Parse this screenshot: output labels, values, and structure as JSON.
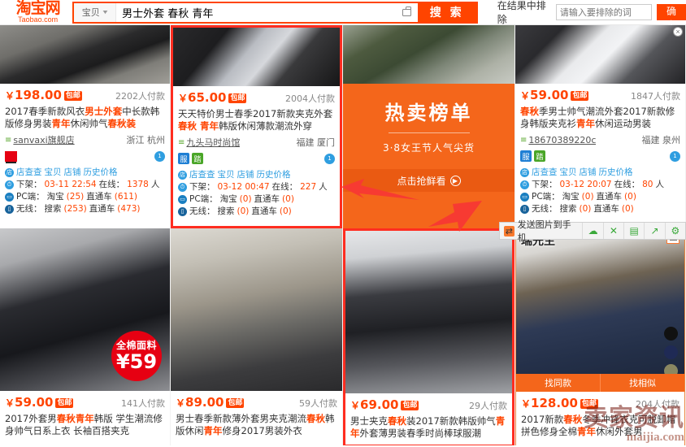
{
  "header": {
    "logo_cn": "淘宝网",
    "logo_en": "Taobao.com",
    "category": "宝贝",
    "search_value": "男士外套 春秋 青年",
    "camera_icon": "camera-icon",
    "search_button": "搜 索",
    "exclude_label": "在结果中排除",
    "exclude_placeholder": "请输入要排除的词",
    "confirm_button": "确定",
    "close_label": "×"
  },
  "promo": {
    "title": "热卖榜单",
    "subtitle": "3·8女王节人气尖货",
    "cta": "点击抢鲜看",
    "cta_arrow": "▶"
  },
  "toolbar": {
    "send_label": "发送图片到手机",
    "buttons": [
      {
        "name": "cloud-icon",
        "glyph": "☁"
      },
      {
        "name": "shuffle-icon",
        "glyph": "✕"
      },
      {
        "name": "save-icon",
        "glyph": "▤"
      },
      {
        "name": "share-icon",
        "glyph": "↗"
      },
      {
        "name": "settings-icon",
        "glyph": "⚙"
      }
    ]
  },
  "labels": {
    "stat_shop_check": "店查查",
    "stat_baobei": "宝贝",
    "stat_dianpu": "店铺",
    "stat_history": "历史价格",
    "stat_offshelf": "下架：",
    "stat_online": "在线：",
    "stat_online_unit": "人",
    "stat_pc": "PC端：",
    "stat_taobao": "淘宝",
    "stat_zhitongche": "直通车",
    "stat_wireless": "无线：",
    "stat_search": "搜索",
    "free_ship": "包邮",
    "menu_icon": "≡"
  },
  "watermark": {
    "cn": "卖家资讯",
    "en": "maijia.com"
  },
  "products": [
    {
      "price": "198.00",
      "deals": "2202人付款",
      "title_parts": [
        {
          "t": "2017春季新款风衣",
          "kw": false
        },
        {
          "t": "男士外套",
          "kw": true
        },
        {
          "t": "中长款韩版修身男装",
          "kw": false
        },
        {
          "t": "青年",
          "kw": true
        },
        {
          "t": "休闲帅气",
          "kw": false
        },
        {
          "t": "春秋装",
          "kw": true
        }
      ],
      "shop": "sanvaxi旗舰店",
      "location": "浙江 杭州",
      "tags": [
        "tmall"
      ],
      "offshelf": "03-11 22:54",
      "online": "1378",
      "pc_taobao": "(25)",
      "pc_ztc": "(611)",
      "wl_search": "(253)",
      "wl_ztc": "(473)",
      "photo": "ph1",
      "highlight": false
    },
    {
      "price": "65.00",
      "deals": "2004人付款",
      "title_parts": [
        {
          "t": "天天特价男士春季2017新款夹克外套",
          "kw": false
        },
        {
          "t": "春秋 青年",
          "kw": true
        },
        {
          "t": "韩版休闲薄款潮流外穿",
          "kw": false
        }
      ],
      "shop": "九头马时尚馆",
      "location": "福建 厦门",
      "tags": [
        "fu",
        "zhan"
      ],
      "offshelf": "03-12 00:47",
      "online": "227",
      "pc_taobao": "(0)",
      "pc_ztc": "(0)",
      "wl_search": "(0)",
      "wl_ztc": "(0)",
      "photo": "ph2",
      "highlight": true
    },
    {
      "price": "59.00",
      "deals": "1847人付款",
      "title_parts": [
        {
          "t": "春秋",
          "kw": true
        },
        {
          "t": "季男士帅气潮流外套2017新款修身韩版夹克衫",
          "kw": false
        },
        {
          "t": "青年",
          "kw": true
        },
        {
          "t": "休闲运动男装",
          "kw": false
        }
      ],
      "shop": "18670389220c",
      "location": "福建 泉州",
      "tags": [
        "fu",
        "zhan"
      ],
      "offshelf": "03-12 20:07",
      "online": "80",
      "pc_taobao": "(0)",
      "pc_ztc": "(0)",
      "wl_search": "(0)",
      "wl_ztc": "(0)",
      "photo": "ph4",
      "highlight": false
    },
    {
      "price": "59.00",
      "deals": "141人付款",
      "title_parts": [
        {
          "t": "2017外套男",
          "kw": false
        },
        {
          "t": "春秋青年",
          "kw": true
        },
        {
          "t": "韩版 学生潮流修身帅气日系上衣 长袖百搭夹克",
          "kw": false
        }
      ],
      "badge_top": "全棉面料",
      "badge_price": "¥59",
      "photo": "ph5",
      "highlight": false
    },
    {
      "price": "89.00",
      "deals": "59人付款",
      "title_parts": [
        {
          "t": "男士春季新款薄外套男夹克潮流",
          "kw": false
        },
        {
          "t": "春秋",
          "kw": true
        },
        {
          "t": "韩版休闲",
          "kw": false
        },
        {
          "t": "青年",
          "kw": true
        },
        {
          "t": "修身2017男装外衣",
          "kw": false
        }
      ],
      "photo": "ph6",
      "highlight": false
    },
    {
      "price": "69.00",
      "deals": "29人付款",
      "title_parts": [
        {
          "t": "男士夹克",
          "kw": false
        },
        {
          "t": "春秋",
          "kw": true
        },
        {
          "t": "装2017新款韩版帅气",
          "kw": false
        },
        {
          "t": "青年",
          "kw": true
        },
        {
          "t": "外套薄男装春季时尚棒球服潮",
          "kw": false
        }
      ],
      "photo": "ph7",
      "highlight": true
    },
    {
      "price": "128.00",
      "deals": "204人付款",
      "title_parts": [
        {
          "t": "2017新款",
          "kw": false
        },
        {
          "t": "春秋",
          "kw": true
        },
        {
          "t": "冬季冲锋衣克可脱卸帽拼色修身全棉",
          "kw": false
        },
        {
          "t": "青年",
          "kw": true
        },
        {
          "t": "休闲外套男",
          "kw": false
        }
      ],
      "shop_tag": "瑞先生",
      "colors": [
        "#111111",
        "#1f2a55",
        "#8a8761"
      ],
      "sim_buttons": [
        "找同款",
        "找相似"
      ],
      "photo": "ph8",
      "highlight": false
    }
  ]
}
